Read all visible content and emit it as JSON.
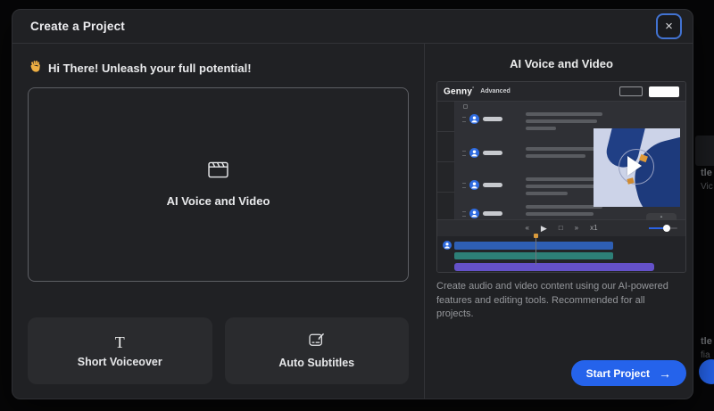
{
  "modal": {
    "title": "Create a Project",
    "close_icon": "×"
  },
  "left": {
    "greeting": "Hi There! Unleash your full potential!",
    "primary_card": {
      "label": "AI Voice and Video"
    },
    "secondary_cards": [
      {
        "label": "Short Voiceover",
        "glyph": "T"
      },
      {
        "label": "Auto Subtitles"
      }
    ]
  },
  "right": {
    "heading": "AI Voice and Video",
    "preview": {
      "app_name": "Genny",
      "logo_mark": "*",
      "plan_label": "Advanced",
      "speed_label": "x1",
      "play_icon": "▶",
      "collapse_icon": "▴"
    },
    "description": "Create audio and video content using our AI-powered features and editing tools. Recommended for all projects.",
    "start_button_label": "Start Project",
    "start_button_arrow": "→"
  },
  "background_fragments": {
    "top_title": "tle",
    "top_sub": "Vic",
    "bottom_title": "tle",
    "bottom_sub": "fia"
  },
  "colors": {
    "accent_blue": "#2563eb",
    "close_ring_blue": "#4273d2",
    "track_blue": "#2e5fb4",
    "track_teal": "#2d7f77",
    "track_purple": "#6451c9",
    "thumb_background": "#ccd3e8",
    "thumb_navy": "#1d3a7c",
    "playhead_orange": "#d99a3c"
  }
}
